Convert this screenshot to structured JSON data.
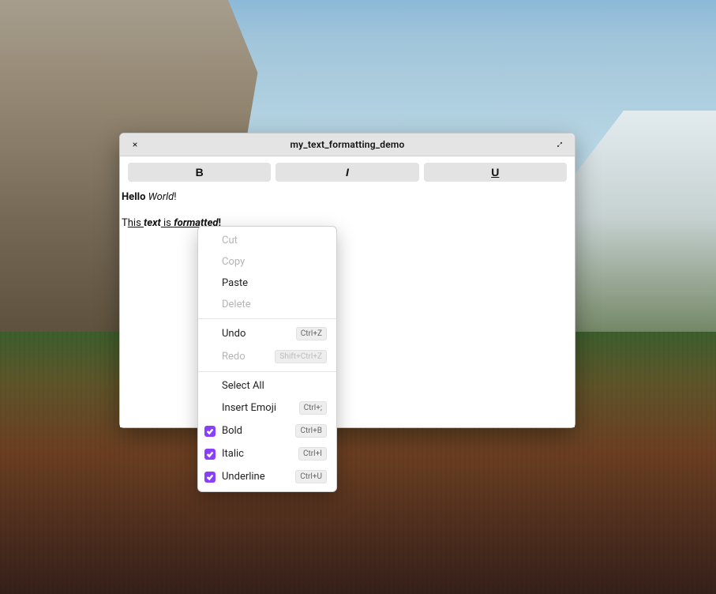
{
  "window": {
    "title": "my_text_formatting_demo"
  },
  "toolbar": {
    "bold_label": "B",
    "italic_label": "I",
    "underline_label": "U"
  },
  "editor": {
    "line1": {
      "t0": "Hello ",
      "t1": "World",
      "t2": "!"
    },
    "line2": {
      "t0": "T",
      "t1": "his ",
      "t2": "text",
      "t3": " is ",
      "t4": "formatted",
      "t5": "!"
    }
  },
  "context_menu": {
    "cut": {
      "label": "Cut",
      "enabled": false
    },
    "copy": {
      "label": "Copy",
      "enabled": false
    },
    "paste": {
      "label": "Paste",
      "enabled": true
    },
    "delete": {
      "label": "Delete",
      "enabled": false
    },
    "undo": {
      "label": "Undo",
      "enabled": true,
      "accel": "Ctrl+Z"
    },
    "redo": {
      "label": "Redo",
      "enabled": false,
      "accel": "Shift+Ctrl+Z"
    },
    "select_all": {
      "label": "Select All",
      "enabled": true
    },
    "emoji": {
      "label": "Insert Emoji",
      "enabled": true,
      "accel": "Ctrl+;"
    },
    "bold": {
      "label": "Bold",
      "enabled": true,
      "accel": "Ctrl+B",
      "checked": true
    },
    "italic": {
      "label": "Italic",
      "enabled": true,
      "accel": "Ctrl+I",
      "checked": true
    },
    "underline": {
      "label": "Underline",
      "enabled": true,
      "accel": "Ctrl+U",
      "checked": true
    }
  }
}
